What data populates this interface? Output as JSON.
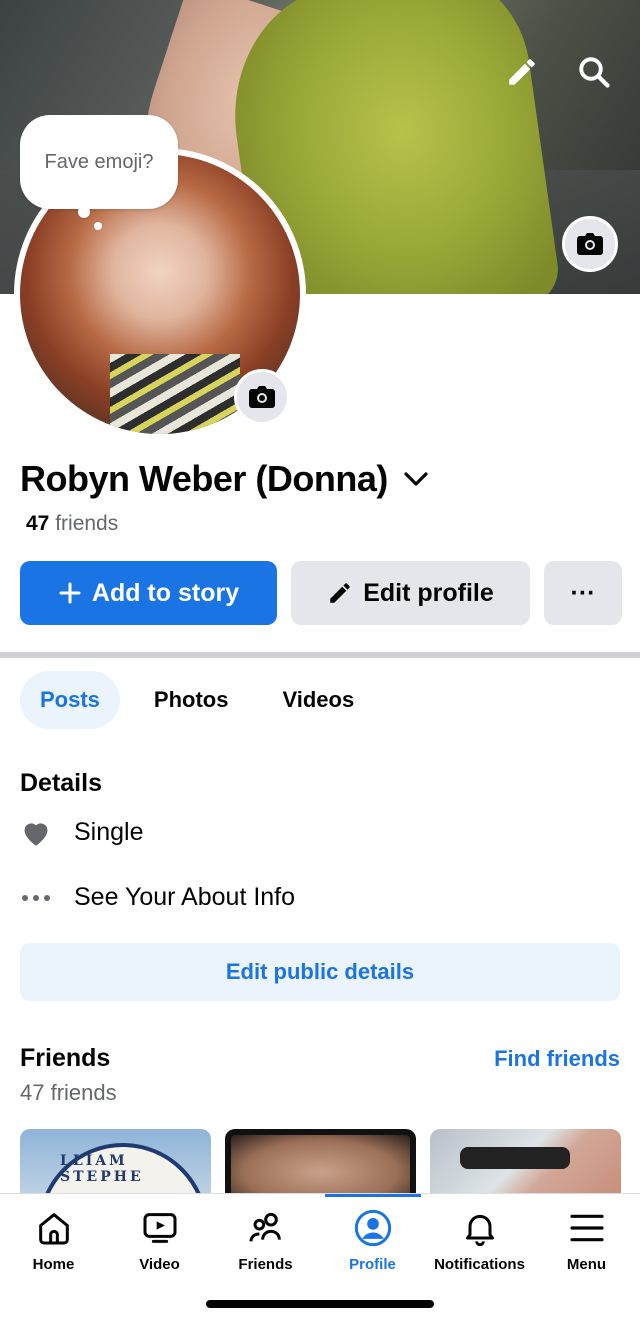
{
  "profile": {
    "name": "Robyn Weber (Donna)",
    "friends_count": "47",
    "friends_label": "friends",
    "bubble_prompt": "Fave emoji?"
  },
  "actions": {
    "add_story": "Add to story",
    "edit_profile": "Edit profile",
    "more": "···"
  },
  "tabs": [
    {
      "label": "Posts",
      "active": true
    },
    {
      "label": "Photos",
      "active": false
    },
    {
      "label": "Videos",
      "active": false
    }
  ],
  "details": {
    "title": "Details",
    "relationship": "Single",
    "about_link": "See Your About Info",
    "edit_public": "Edit public details"
  },
  "friends_section": {
    "title": "Friends",
    "find_friends": "Find friends",
    "count_text": "47 friends",
    "thumb1_text": "LLIAM STEPHE"
  },
  "bottom_nav": [
    {
      "label": "Home",
      "icon": "home-icon",
      "active": false
    },
    {
      "label": "Video",
      "icon": "video-icon",
      "active": false
    },
    {
      "label": "Friends",
      "icon": "friends-icon",
      "active": false
    },
    {
      "label": "Profile",
      "icon": "profile-icon",
      "active": true
    },
    {
      "label": "Notifications",
      "icon": "bell-icon",
      "active": false
    },
    {
      "label": "Menu",
      "icon": "menu-icon",
      "active": false
    }
  ],
  "colors": {
    "accent": "#1b74e4",
    "secondary_button": "#e4e6eb",
    "muted_text": "#65676b",
    "tab_active_bg": "#ebf3fd"
  }
}
